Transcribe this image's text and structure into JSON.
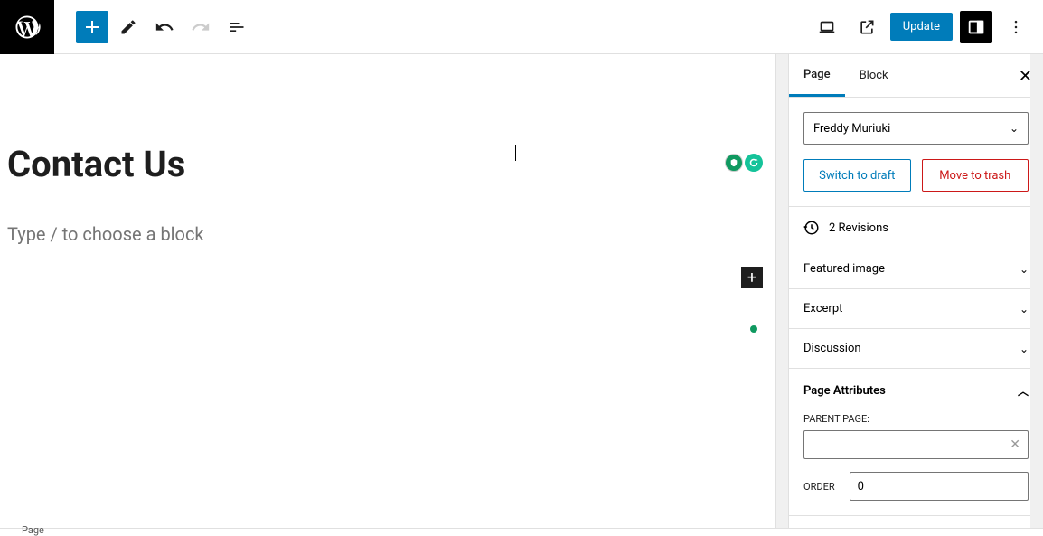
{
  "topbar": {
    "update_label": "Update"
  },
  "tabs": {
    "page": "Page",
    "block": "Block"
  },
  "author": {
    "selected": "Freddy Muriuki"
  },
  "actions": {
    "draft": "Switch to draft",
    "trash": "Move to trash"
  },
  "revisions": "2 Revisions",
  "panels": {
    "featured_image": "Featured image",
    "excerpt": "Excerpt",
    "discussion": "Discussion",
    "page_attributes": "Page Attributes"
  },
  "attributes": {
    "parent_label": "PARENT PAGE:",
    "order_label": "ORDER",
    "order_value": "0"
  },
  "editor": {
    "title": "Contact Us",
    "placeholder": "Type / to choose a block"
  },
  "footer": {
    "breadcrumb": "Page"
  }
}
